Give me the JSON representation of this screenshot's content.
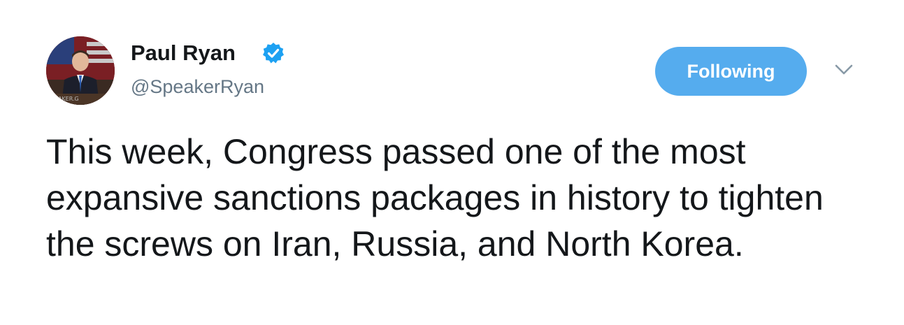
{
  "tweet": {
    "author": {
      "display_name": "Paul Ryan",
      "screen_name": "@SpeakerRyan",
      "verified": true,
      "avatar_watermark": "SPEAKER.G"
    },
    "follow_button_label": "Following",
    "text": "This week, Congress passed one of the most expansive sanctions packages in history to tighten the screws on Iran, Russia, and North Korea."
  },
  "icons": {
    "verified": "verified-badge-icon",
    "caret": "chevron-down-icon"
  },
  "colors": {
    "accent": "#55acee",
    "verified": "#1da1f2",
    "text_primary": "#14171a",
    "text_secondary": "#657786"
  }
}
